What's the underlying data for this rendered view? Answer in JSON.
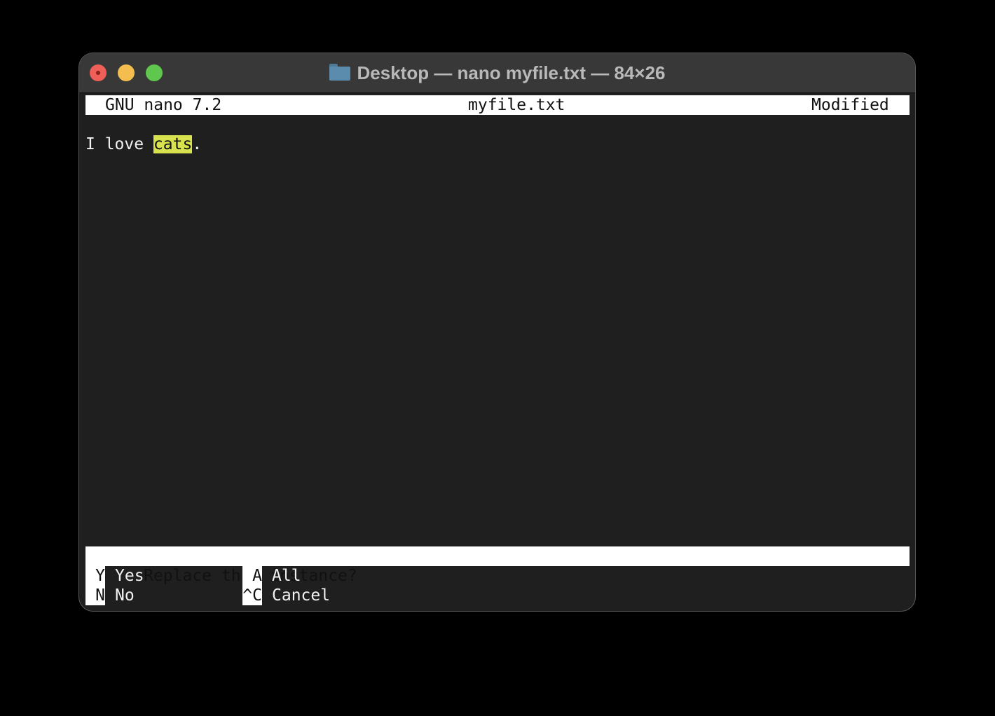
{
  "window": {
    "title": "Desktop — nano myfile.txt — 84×26",
    "title_icon": "folder-icon"
  },
  "nano": {
    "header": {
      "version": "GNU nano 7.2",
      "filename": "myfile.txt",
      "status": "Modified"
    },
    "buffer": {
      "line1_before": "I love ",
      "line1_match": "cats",
      "line1_after": "."
    },
    "prompt": "Replace this instance?",
    "shortcuts": [
      {
        "key": "Y",
        "label": "Yes"
      },
      {
        "key": "A",
        "label": "All"
      },
      {
        "key": "N",
        "label": "No"
      },
      {
        "key": "^C",
        "label": "Cancel"
      }
    ]
  },
  "colors": {
    "highlight": "#d7e24e",
    "terminal_bg": "#1f1f1f",
    "titlebar_bg": "#383838"
  }
}
